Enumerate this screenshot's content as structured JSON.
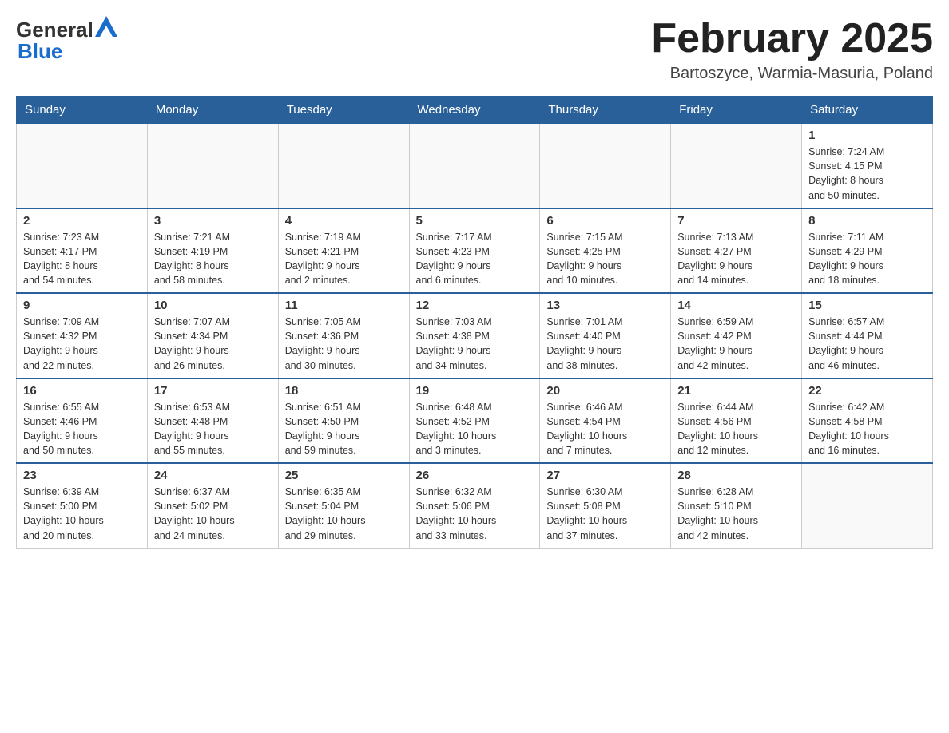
{
  "header": {
    "logo": {
      "general": "General",
      "blue": "Blue"
    },
    "title": "February 2025",
    "location": "Bartoszyce, Warmia-Masuria, Poland"
  },
  "weekdays": [
    "Sunday",
    "Monday",
    "Tuesday",
    "Wednesday",
    "Thursday",
    "Friday",
    "Saturday"
  ],
  "weeks": [
    [
      {
        "day": "",
        "info": ""
      },
      {
        "day": "",
        "info": ""
      },
      {
        "day": "",
        "info": ""
      },
      {
        "day": "",
        "info": ""
      },
      {
        "day": "",
        "info": ""
      },
      {
        "day": "",
        "info": ""
      },
      {
        "day": "1",
        "info": "Sunrise: 7:24 AM\nSunset: 4:15 PM\nDaylight: 8 hours\nand 50 minutes."
      }
    ],
    [
      {
        "day": "2",
        "info": "Sunrise: 7:23 AM\nSunset: 4:17 PM\nDaylight: 8 hours\nand 54 minutes."
      },
      {
        "day": "3",
        "info": "Sunrise: 7:21 AM\nSunset: 4:19 PM\nDaylight: 8 hours\nand 58 minutes."
      },
      {
        "day": "4",
        "info": "Sunrise: 7:19 AM\nSunset: 4:21 PM\nDaylight: 9 hours\nand 2 minutes."
      },
      {
        "day": "5",
        "info": "Sunrise: 7:17 AM\nSunset: 4:23 PM\nDaylight: 9 hours\nand 6 minutes."
      },
      {
        "day": "6",
        "info": "Sunrise: 7:15 AM\nSunset: 4:25 PM\nDaylight: 9 hours\nand 10 minutes."
      },
      {
        "day": "7",
        "info": "Sunrise: 7:13 AM\nSunset: 4:27 PM\nDaylight: 9 hours\nand 14 minutes."
      },
      {
        "day": "8",
        "info": "Sunrise: 7:11 AM\nSunset: 4:29 PM\nDaylight: 9 hours\nand 18 minutes."
      }
    ],
    [
      {
        "day": "9",
        "info": "Sunrise: 7:09 AM\nSunset: 4:32 PM\nDaylight: 9 hours\nand 22 minutes."
      },
      {
        "day": "10",
        "info": "Sunrise: 7:07 AM\nSunset: 4:34 PM\nDaylight: 9 hours\nand 26 minutes."
      },
      {
        "day": "11",
        "info": "Sunrise: 7:05 AM\nSunset: 4:36 PM\nDaylight: 9 hours\nand 30 minutes."
      },
      {
        "day": "12",
        "info": "Sunrise: 7:03 AM\nSunset: 4:38 PM\nDaylight: 9 hours\nand 34 minutes."
      },
      {
        "day": "13",
        "info": "Sunrise: 7:01 AM\nSunset: 4:40 PM\nDaylight: 9 hours\nand 38 minutes."
      },
      {
        "day": "14",
        "info": "Sunrise: 6:59 AM\nSunset: 4:42 PM\nDaylight: 9 hours\nand 42 minutes."
      },
      {
        "day": "15",
        "info": "Sunrise: 6:57 AM\nSunset: 4:44 PM\nDaylight: 9 hours\nand 46 minutes."
      }
    ],
    [
      {
        "day": "16",
        "info": "Sunrise: 6:55 AM\nSunset: 4:46 PM\nDaylight: 9 hours\nand 50 minutes."
      },
      {
        "day": "17",
        "info": "Sunrise: 6:53 AM\nSunset: 4:48 PM\nDaylight: 9 hours\nand 55 minutes."
      },
      {
        "day": "18",
        "info": "Sunrise: 6:51 AM\nSunset: 4:50 PM\nDaylight: 9 hours\nand 59 minutes."
      },
      {
        "day": "19",
        "info": "Sunrise: 6:48 AM\nSunset: 4:52 PM\nDaylight: 10 hours\nand 3 minutes."
      },
      {
        "day": "20",
        "info": "Sunrise: 6:46 AM\nSunset: 4:54 PM\nDaylight: 10 hours\nand 7 minutes."
      },
      {
        "day": "21",
        "info": "Sunrise: 6:44 AM\nSunset: 4:56 PM\nDaylight: 10 hours\nand 12 minutes."
      },
      {
        "day": "22",
        "info": "Sunrise: 6:42 AM\nSunset: 4:58 PM\nDaylight: 10 hours\nand 16 minutes."
      }
    ],
    [
      {
        "day": "23",
        "info": "Sunrise: 6:39 AM\nSunset: 5:00 PM\nDaylight: 10 hours\nand 20 minutes."
      },
      {
        "day": "24",
        "info": "Sunrise: 6:37 AM\nSunset: 5:02 PM\nDaylight: 10 hours\nand 24 minutes."
      },
      {
        "day": "25",
        "info": "Sunrise: 6:35 AM\nSunset: 5:04 PM\nDaylight: 10 hours\nand 29 minutes."
      },
      {
        "day": "26",
        "info": "Sunrise: 6:32 AM\nSunset: 5:06 PM\nDaylight: 10 hours\nand 33 minutes."
      },
      {
        "day": "27",
        "info": "Sunrise: 6:30 AM\nSunset: 5:08 PM\nDaylight: 10 hours\nand 37 minutes."
      },
      {
        "day": "28",
        "info": "Sunrise: 6:28 AM\nSunset: 5:10 PM\nDaylight: 10 hours\nand 42 minutes."
      },
      {
        "day": "",
        "info": ""
      }
    ]
  ],
  "colors": {
    "header_bg": "#2a6099",
    "header_text": "#ffffff",
    "border": "#aaaaaa",
    "day_border_top": "#2a6099"
  }
}
